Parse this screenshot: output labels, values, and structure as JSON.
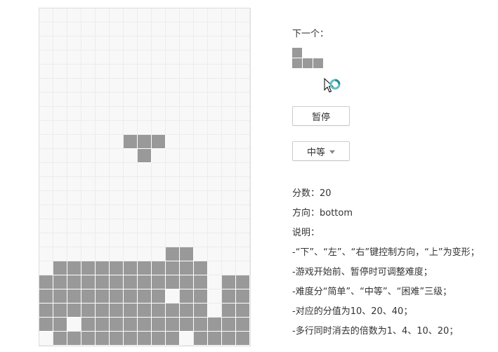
{
  "game": {
    "columns": 15,
    "rows": 24,
    "settled_rows": {
      "17": "000000000110000",
      "18": "011111111111000",
      "19": "111111111111011",
      "20": "111111111011011",
      "21": "111111111111011",
      "22": "110111111111111",
      "23": "011111111101111"
    },
    "active_piece": {
      "shape": "T",
      "cells": [
        [
          9,
          6
        ],
        [
          9,
          7
        ],
        [
          9,
          8
        ],
        [
          10,
          7
        ]
      ]
    },
    "cell_color": "#999999",
    "empty_color": "#f8f8f8"
  },
  "sidebar": {
    "next_label": "下一个：",
    "next_piece": {
      "shape": "J",
      "cells": [
        [
          0,
          0
        ],
        [
          1,
          0
        ],
        [
          1,
          1
        ],
        [
          1,
          2
        ]
      ]
    },
    "pause_label": "暂停",
    "level_label": "中等",
    "score_line": "分数：20",
    "direction_line": "方向：bottom",
    "help_title": "说明：",
    "help_lines": [
      "-“下”、“左”、“右”键控制方向，“上”为变形；",
      "-游戏开始前、暂停时可调整难度；",
      "-难度分“简单”、“中等”、“困难”三级；",
      "-对应的分值为10、20、40；",
      "-多行同时消去的倍数为1、4、10、20；"
    ]
  }
}
